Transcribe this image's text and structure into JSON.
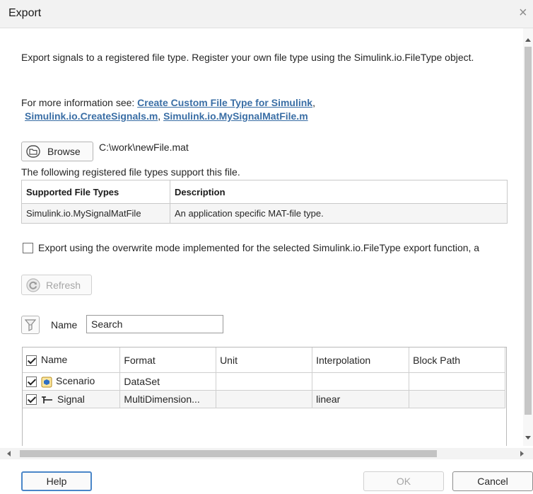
{
  "dialog": {
    "title": "Export",
    "close_glyph": "×"
  },
  "intro": {
    "text": "Export signals to a registered file type. Register your own file type using the Simulink.io.FileType object.",
    "more_info_prefix": "For more information see: ",
    "links": [
      "Create Custom File Type for Simulink",
      "Simulink.io.CreateSignals.m",
      "Simulink.io.MySignalMatFile.m"
    ],
    "sep1": ",",
    "sep2": ", "
  },
  "browse": {
    "label": "Browse",
    "icon": "folder-icon",
    "path": "C:\\work\\newFile.mat"
  },
  "file_types": {
    "note": "The following registered file types support this file.",
    "headers": [
      "Supported File Types",
      "Description"
    ],
    "rows": [
      [
        "Simulink.io.MySignalMatFile",
        "An application specific MAT-file type."
      ]
    ]
  },
  "overwrite": {
    "checked": false,
    "label": "Export using the overwrite mode implemented for the selected Simulink.io.FileType export function, a"
  },
  "refresh": {
    "label": "Refresh",
    "icon": "refresh-icon",
    "enabled": false
  },
  "filter": {
    "icon": "filter-icon",
    "name_label": "Name",
    "search_value": "Search"
  },
  "signals": {
    "headers": [
      "Name",
      "Format",
      "Unit",
      "Interpolation",
      "Block Path"
    ],
    "header_checked": true,
    "rows": [
      {
        "checked": true,
        "icon": "scenario-icon",
        "name": "Scenario",
        "format": "DataSet",
        "unit": "",
        "interpolation": "",
        "block_path": ""
      },
      {
        "checked": true,
        "icon": "signal-icon",
        "name": "Signal",
        "format": "MultiDimension...",
        "unit": "",
        "interpolation": "linear",
        "block_path": ""
      }
    ]
  },
  "footer": {
    "help": "Help",
    "ok": "OK",
    "cancel": "Cancel"
  },
  "colors": {
    "link": "#3a6ea5",
    "focus_border": "#4a86c8",
    "disabled_text": "#a6a6a6"
  }
}
